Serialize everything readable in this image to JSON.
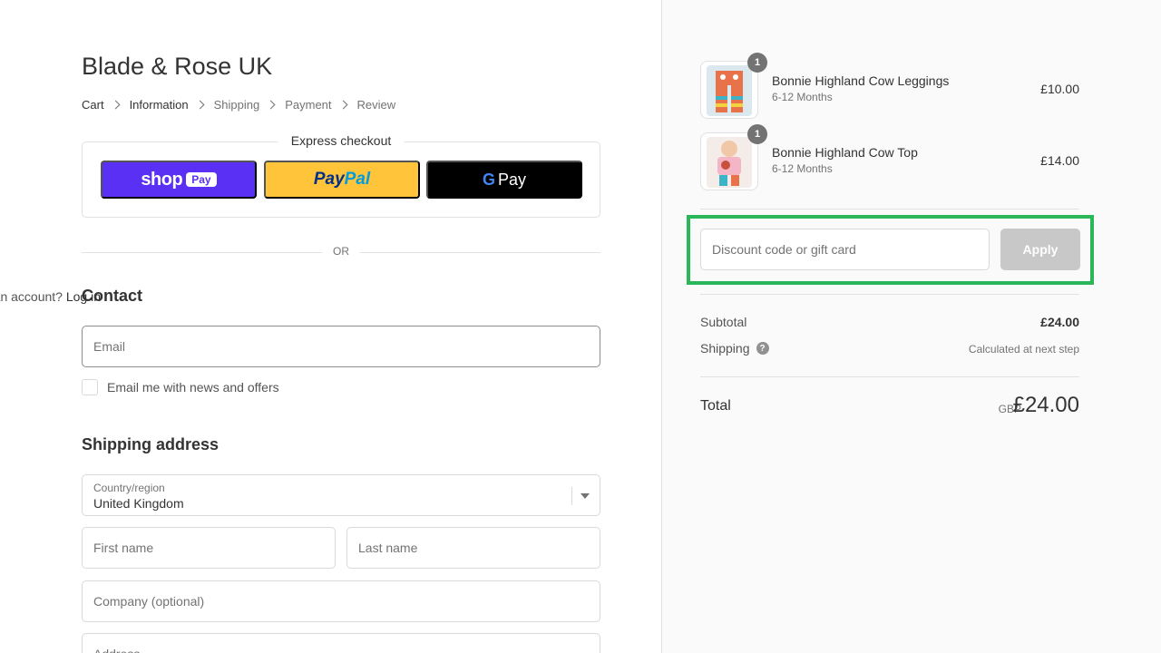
{
  "store": {
    "name": "Blade & Rose UK"
  },
  "breadcrumb": [
    "Cart",
    "Information",
    "Shipping",
    "Payment",
    "Review"
  ],
  "express_checkout": {
    "title": "Express checkout",
    "shop_pay": {
      "word": "shop",
      "pill": "Pay"
    },
    "paypal": {
      "part1": "Pay",
      "part2": "Pal"
    },
    "gpay": {
      "g": "G",
      "word": "Pay"
    }
  },
  "divider_or": "OR",
  "contact": {
    "title": "Contact",
    "account_prompt": "Have an account?",
    "login_label": "Log in",
    "email_placeholder": "Email",
    "newsletter_label": "Email me with news and offers"
  },
  "shipping_address": {
    "title": "Shipping address",
    "country_label": "Country/region",
    "country_value": "United Kingdom",
    "first_name_placeholder": "First name",
    "last_name_placeholder": "Last name",
    "company_placeholder": "Company (optional)",
    "address_placeholder": "Address"
  },
  "order": {
    "items": [
      {
        "name": "Bonnie Highland Cow Leggings",
        "variant": "6-12 Months",
        "price": "£10.00",
        "quantity": "1"
      },
      {
        "name": "Bonnie Highland Cow Top",
        "variant": "6-12 Months",
        "price": "£14.00",
        "quantity": "1"
      }
    ],
    "discount_placeholder": "Discount code or gift card",
    "apply_label": "Apply",
    "subtotal_label": "Subtotal",
    "subtotal_value": "£24.00",
    "shipping_label": "Shipping",
    "shipping_help": "?",
    "shipping_value": "Calculated at next step",
    "total_label": "Total",
    "currency": "GBP",
    "total_value": "£24.00"
  },
  "colors": {
    "shop_pay": "#5a31f4",
    "paypal": "#ffc439",
    "gpay": "#000000",
    "highlight": "#2cb65a",
    "apply_disabled": "#c8c8c8"
  }
}
